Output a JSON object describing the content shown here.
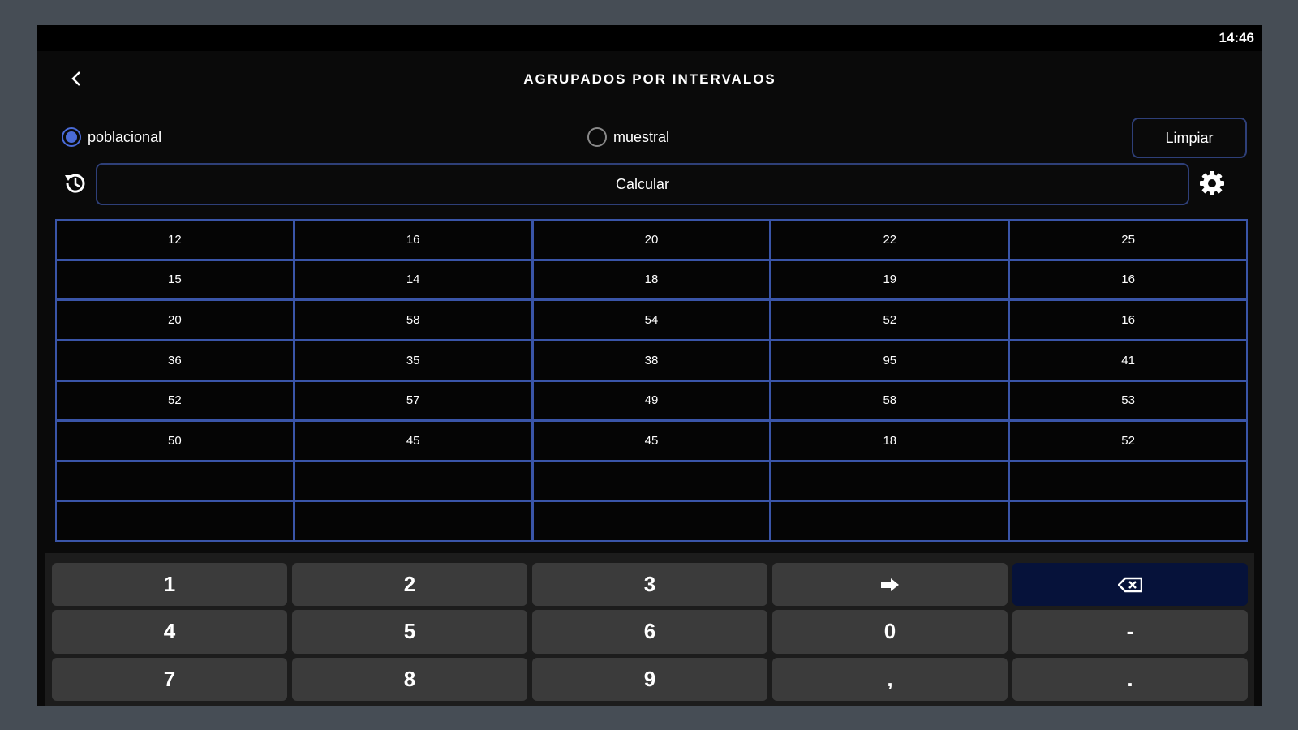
{
  "status_bar": {
    "time": "14:46"
  },
  "header": {
    "title": "AGRUPADOS POR INTERVALOS"
  },
  "options": {
    "poblacional_label": "poblacional",
    "muestral_label": "muestral",
    "selected": "poblacional"
  },
  "actions": {
    "clear_label": "Limpiar",
    "calculate_label": "Calcular"
  },
  "accent_color": "#3a55a8",
  "table": {
    "rows": [
      [
        "12",
        "16",
        "20",
        "22",
        "25"
      ],
      [
        "15",
        "14",
        "18",
        "19",
        "16"
      ],
      [
        "20",
        "58",
        "54",
        "52",
        "16"
      ],
      [
        "36",
        "35",
        "38",
        "95",
        "41"
      ],
      [
        "52",
        "57",
        "49",
        "58",
        "53"
      ],
      [
        "50",
        "45",
        "45",
        "18",
        "52"
      ],
      [
        "",
        "",
        "",
        "",
        ""
      ],
      [
        "",
        "",
        "",
        "",
        ""
      ]
    ]
  },
  "keypad": {
    "keys": [
      "1",
      "2",
      "3",
      "enter-icon",
      "backspace-icon",
      "4",
      "5",
      "6",
      "0",
      "-",
      "7",
      "8",
      "9",
      ",",
      "."
    ]
  }
}
